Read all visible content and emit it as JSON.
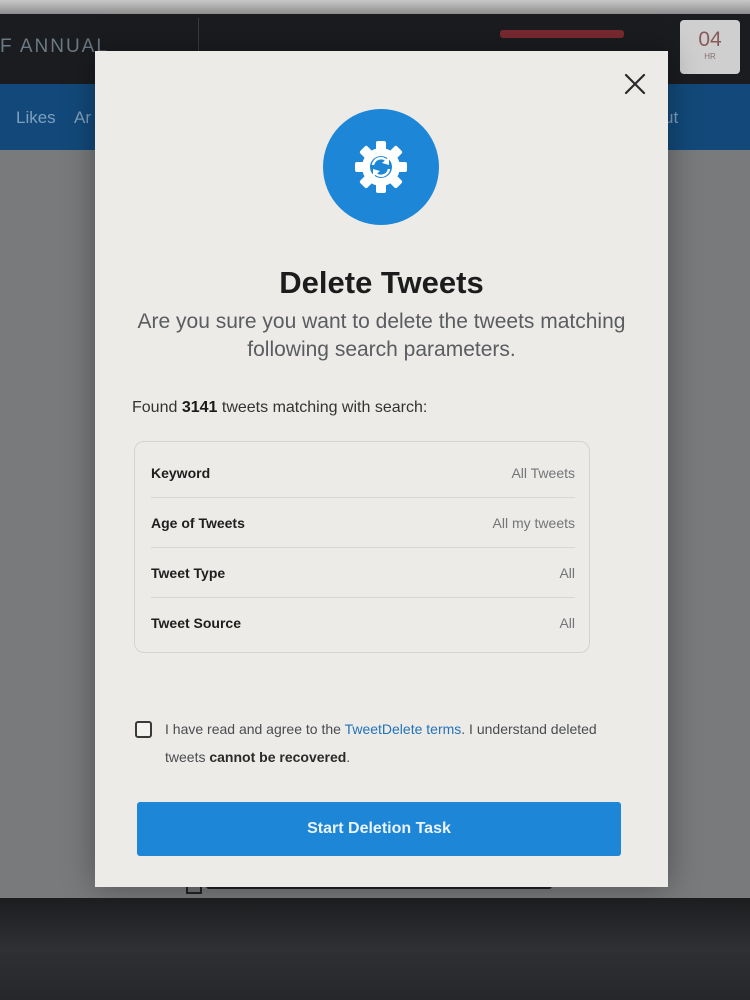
{
  "background": {
    "brand_text": "F ANNUAL",
    "timer_value": "04",
    "timer_unit": "HR",
    "nav": {
      "likes": "Likes",
      "partial_left": "Ar",
      "partial_right": "ut"
    }
  },
  "modal": {
    "title": "Delete Tweets",
    "subtitle": "Are you sure you want to delete the tweets matching following search parameters.",
    "found_prefix": "Found",
    "found_count": "3141",
    "found_suffix": "tweets matching with search:",
    "parameters": [
      {
        "label": "Keyword",
        "value": "All Tweets"
      },
      {
        "label": "Age of Tweets",
        "value": "All my tweets"
      },
      {
        "label": "Tweet Type",
        "value": "All"
      },
      {
        "label": "Tweet Source",
        "value": "All"
      }
    ],
    "terms": {
      "checked": false,
      "prefix": "I have read and agree to the",
      "link": "TweetDelete terms",
      "middle": ". I understand deleted tweets",
      "bold": "cannot be recovered",
      "suffix": "."
    },
    "start_button": "Start Deletion Task",
    "icons": {
      "close": "close-icon",
      "header": "gear-sync-icon"
    },
    "colors": {
      "accent": "#1d86d6",
      "link": "#2273b8"
    }
  }
}
